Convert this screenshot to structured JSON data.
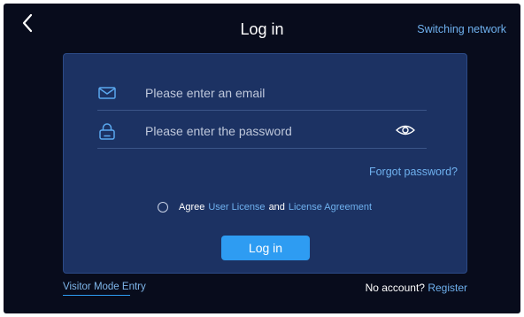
{
  "header": {
    "title": "Log in",
    "switch_network": "Switching network",
    "back_icon": "chevron-left-icon"
  },
  "form": {
    "email_placeholder": "Please enter an email",
    "email_value": "",
    "email_icon": "envelope-icon",
    "password_placeholder": "Please enter the password",
    "password_value": "",
    "password_icon": "lock-icon",
    "visibility_icon": "eye-icon",
    "forgot": "Forgot password?",
    "agree_prefix": "Agree",
    "user_license": "User License",
    "and": "and",
    "license_agreement": "License Agreement",
    "login_button": "Log in"
  },
  "footer": {
    "visitor": "Visitor Mode Entry",
    "no_account": "No account?",
    "register": "Register"
  },
  "colors": {
    "background": "#080c1c",
    "card": "#1c3263",
    "accent": "#2e9cf2",
    "link": "#6fb1ef"
  }
}
